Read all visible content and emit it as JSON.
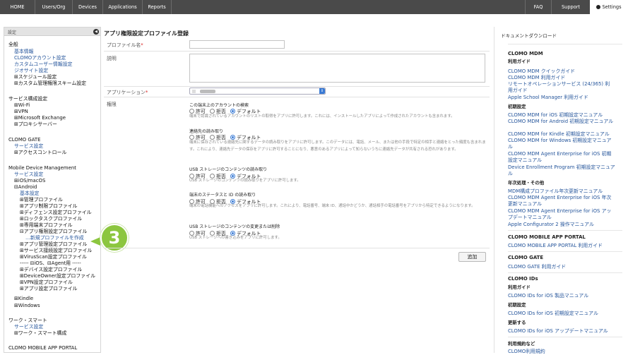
{
  "topnav": {
    "left": [
      "HOME",
      "Users/Org",
      "Devices",
      "Applications",
      "Reports"
    ],
    "right": [
      "FAQ",
      "Support"
    ],
    "settings": "Settings"
  },
  "sidebar": {
    "title": "設定",
    "items": [
      "全般",
      "基本情報",
      "CLOMOアカウント設定",
      "カスタムユーザー情報設定",
      "ジオサイト設定",
      "⊞スケジュール設定",
      "⊞カスタム管理権限スキーム設定",
      "サービス構成設定",
      "⊞Wi-Fi",
      "⊞VPN",
      "⊞Microsoft Exchange",
      "⊞プロキシサーバー",
      "CLOMO GATE",
      "サービス設定",
      "⊞アクセスコントロール",
      "Mobile Device Management",
      "サービス設定",
      "⊞iOS/macOS",
      "⊟Android",
      "基本設定",
      "⊞管理プロファイル",
      "⊞アプリ制限プロファイル",
      "⊞ディフェンス設定プロファイル",
      "⊞ロックタスクプロファイル",
      "⊞専用端末プロファイル",
      "⊟アプリ権限設定プロファイル",
      "…新規プロファイルを作成",
      "⊞アプリ管理設定プロファイル",
      "⊞サービス接続設定プロファイル",
      "⊞VirusScan設定プロファイル",
      "----- ⊟iOS、⊟Agent用 -----",
      "⊞デバイス設定プロファイル",
      "⊞DeviceOwner設定プロファイル",
      "⊞VPN設定プロファイル",
      "⊞アプリ設定プロファイル",
      "⊞Kindle",
      "⊞Windows",
      "ワーク・スマート",
      "サービス設定",
      "⊞ワーク・スマート構成",
      "CLOMO MOBILE APP PORTAL"
    ]
  },
  "callout": "3",
  "main": {
    "title": "アプリ権限設定プロファイル登録",
    "name_label": "プロファイル名",
    "required": "*",
    "desc_label": "説明",
    "app_label": "アプリケーション",
    "perm_label": "権限",
    "name_value": "",
    "desc_value": "",
    "radio_options": [
      "許可",
      "拒否",
      "デフォルト"
    ],
    "permissions": [
      {
        "title": "この端末上のアカウントの検索",
        "desc": "端末で認識されているアカウントのリストの取得をアプリに許可します。これには、インストールしたアプリによって作成されたアカウントも含まれます。",
        "selected": "デフォルト"
      },
      {
        "title": "連絡先の読み取り",
        "desc": "端末に保存されている連絡先に関するデータの読み取りをアプリに許可します。このデータには、電話、メール、または他の手段で特定の相手と連絡をとった頻度も含まれます。これにより、連絡先データの保存をアプリに許可することになり、悪意のあるアプリによって知らないうちに連絡先データが共有される恐れがあります。",
        "selected": "デフォルト"
      },
      {
        "title": "USB ストレージのコンテンツの読み取り",
        "desc": "USB ストレージのコンテンツの読み取りをアプリに許可します。",
        "selected": "デフォルト"
      },
      {
        "title": "端末のステータスと ID の読み取り",
        "desc": "端末の電話機能へのアクセスをアプリに許可します。これにより、電話番号、端末 ID、通話中かどうか、通話相手の電話番号をアプリから特定できるようになります。",
        "selected": "デフォルト"
      },
      {
        "title": "USB ストレージのコンテンツの変更または削除",
        "desc": "USB ストレージへの書き込みをアプリに許可します。",
        "selected": "デフォルト"
      }
    ],
    "add_button": "追加"
  },
  "docs": {
    "title": "ドキュメントダウンロード",
    "items": [
      "CLOMO MDM",
      "利用ガイド",
      "CLOMO MDM クイックガイド",
      "CLOMO MDM 利用ガイド",
      "リモートオペレーションサービス (24/365) 利",
      "用ガイド",
      "Apple School Manager 利用ガイド",
      "初期設定",
      "CLOMO MDM for iOS 初期設定マニュアル",
      "CLOMO MDM for Android 初期設定マニュアル",
      "CLOMO MDM for Kindle 初期設定マニュアル",
      "CLOMO MDM for Windows 初期設定マニュア",
      "ル",
      "CLOMO MDM Agent Enterprise for iOS 初期",
      "設定マニュアル",
      "Device Enrollment Program 初期設定マニュア",
      "ル",
      "年次処理・その他",
      "MDM構成プロファイル年次更新マニュアル",
      "CLOMO MDM Agent Enterprise for iOS 年次",
      "更新マニュアル",
      "CLOMO MDM Agent Enterprise for iOS アッ",
      "プデートマニュアル",
      "Apple Configurator 2 操作マニュアル",
      "CLOMO MOBILE APP PORTAL",
      "CLOMO MOBILE APP PORTAL 利用ガイド",
      "CLOMO GATE",
      "CLOMO GATE 利用ガイド",
      "CLOMO IDs",
      "利用ガイド",
      "CLOMO IDs for iOS 製品マニュアル",
      "初期設定",
      "CLOMO IDs for iOS 初期設定マニュアル",
      "更新する",
      "CLOMO IDs for iOS アップデートマニュアル",
      "利用規約など",
      "CLOMO利用規約"
    ]
  }
}
